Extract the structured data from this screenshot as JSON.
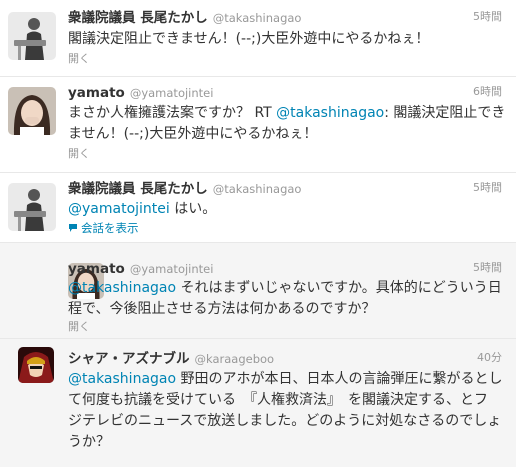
{
  "colors": {
    "link": "#0084b4",
    "meta": "#999999",
    "text": "#333333",
    "reply_bg": "#f5f5f5"
  },
  "tweets": [
    {
      "avatar": "politician-photo",
      "name": "衆議院議員 長尾たかし",
      "handle": "@takashinagao",
      "time": "5時間",
      "line1": "閣議決定阻止できません！(--;)大臣外遊中にやるかねぇ！",
      "action": "開く"
    },
    {
      "avatar": "woman-photo",
      "name": "yamato",
      "handle": "@yamatojintei",
      "time": "6時間",
      "line1_a": "まさか人権擁護法案ですか？ RT ",
      "line1_mention": "@takashinagao",
      "line1_b": ": 閣議決定阻止でき",
      "line2": "ません！(--;)大臣外遊中にやるかねぇ！",
      "action": "開く"
    },
    {
      "avatar": "politician-photo",
      "name": "衆議院議員 長尾たかし",
      "handle": "@takashinagao",
      "time": "5時間",
      "mention": "@yamatojintei",
      "line1": " はい。",
      "action": "会話を表示"
    },
    {
      "avatar": "woman-photo",
      "name": "yamato",
      "handle": "@yamatojintei",
      "time": "5時間",
      "mention": "@takashinagao",
      "line1": " それはまずいじゃないですか。具体的にどういう日",
      "line2": "程で、今後阻止させる方法は何かあるのですか？",
      "action": "開く"
    },
    {
      "avatar": "anime-avatar",
      "name": "シャア・アズナブル",
      "handle": "@karaageboo",
      "time": "40分",
      "mention": "@takashinagao",
      "line1": " 野田のアホが本日、日本人の言論弾圧に繋がるとし",
      "line2": "て何度も抗議を受けている　『人権救済法』　を閣議決定する、とフ",
      "line3": "ジテレビのニュースで放送しました。どのように対処なさるのでしょ",
      "line4": "うか？"
    }
  ]
}
